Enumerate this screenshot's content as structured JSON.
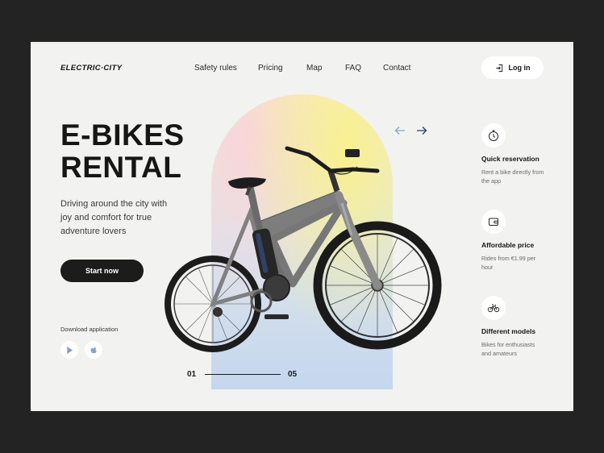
{
  "brand": {
    "logo": "ELECTRIC·CITY"
  },
  "nav": {
    "items": [
      "Safety rules",
      "Pricing",
      "Map",
      "FAQ",
      "Contact"
    ]
  },
  "login": {
    "label": "Log in",
    "icon": "login-icon"
  },
  "hero": {
    "title_line1": "E-BIKES",
    "title_line2": "RENTAL",
    "description": "Driving around the city with joy and comfort for true adventure lovers",
    "cta_label": "Start now"
  },
  "download": {
    "label": "Download application",
    "stores": [
      "google-play-icon",
      "apple-icon"
    ]
  },
  "carousel": {
    "current": "01",
    "total": "05",
    "prev_icon": "arrow-left-icon",
    "next_icon": "arrow-right-icon"
  },
  "features": [
    {
      "icon": "clock-icon",
      "title": "Quick reservation",
      "description": "Rent a bike directly from the app"
    },
    {
      "icon": "wallet-icon",
      "title": "Affordable price",
      "description": "Rides from €1.99 per hour"
    },
    {
      "icon": "bike-icon",
      "title": "Different models",
      "description": "Bikes for enthusiasts and amateurs"
    }
  ],
  "colors": {
    "page_bg": "#232323",
    "card_bg": "#f2f2f0",
    "dark": "#1c1c1c",
    "arrow_prev": "#8fa3c9",
    "arrow_next": "#2a3b6b"
  }
}
